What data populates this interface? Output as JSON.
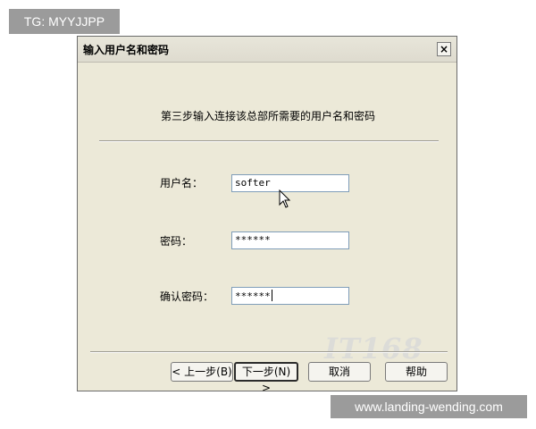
{
  "overlay": {
    "tag": "TG: MYYJJPP",
    "watermark_url": "www.landing-wending.com"
  },
  "window": {
    "title": "输入用户名和密码",
    "close_glyph": "×"
  },
  "content": {
    "heading": "第三步输入连接该总部所需要的用户名和密码"
  },
  "fields": {
    "username": {
      "label": "用户名：",
      "value": "softer"
    },
    "password": {
      "label": "密码：",
      "value": "******"
    },
    "confirm": {
      "label": "确认密码：",
      "value": "******"
    }
  },
  "buttons": {
    "back": "< 上一步(B)",
    "next": "下一步(N) >",
    "cancel": "取消",
    "help": "帮助"
  },
  "logo": {
    "text": "IT168"
  },
  "icons": {
    "cursor": "mouse-pointer-icon",
    "close": "close-icon"
  },
  "colors": {
    "window_bg": "#ece9d8",
    "input_border": "#7f9db9",
    "overlay_bg": "#9b9b9b"
  }
}
